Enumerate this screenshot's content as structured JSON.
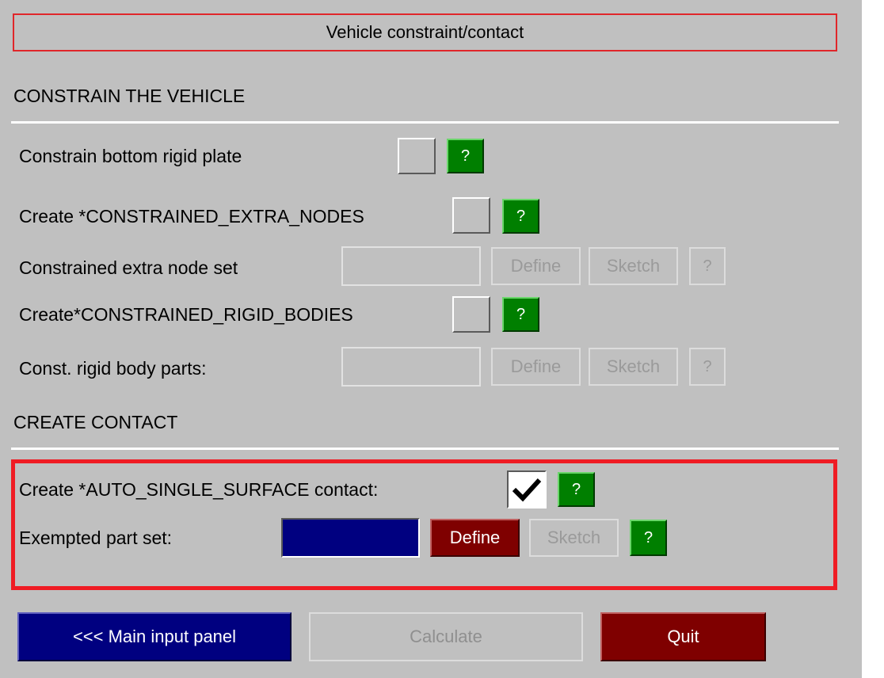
{
  "panel": {
    "title": "Vehicle constraint/contact"
  },
  "constrain_section": {
    "heading": "CONSTRAIN THE VEHICLE",
    "bottom_plate_label": "Constrain bottom rigid plate",
    "extra_nodes_label": "Create *CONSTRAINED_EXTRA_NODES",
    "extra_node_set_label": "Constrained extra node set",
    "rigid_bodies_label": "Create*CONSTRAINED_RIGID_BODIES",
    "rigid_body_parts_label": "Const. rigid body parts:"
  },
  "contact_section": {
    "heading": "CREATE CONTACT",
    "auto_single_surface_label": "Create *AUTO_SINGLE_SURFACE contact:",
    "auto_single_surface_checked": true,
    "exempted_part_set_label": "Exempted part set:"
  },
  "buttons": {
    "help": "?",
    "define": "Define",
    "sketch": "Sketch",
    "main_input_panel": "<<< Main input panel",
    "calculate": "Calculate",
    "quit": "Quit"
  },
  "colors": {
    "panel_background": "#c0c0c0",
    "help_green": "#007f00",
    "navy": "#000080",
    "maroon": "#7f0000",
    "highlight_red": "#ef1c24"
  }
}
